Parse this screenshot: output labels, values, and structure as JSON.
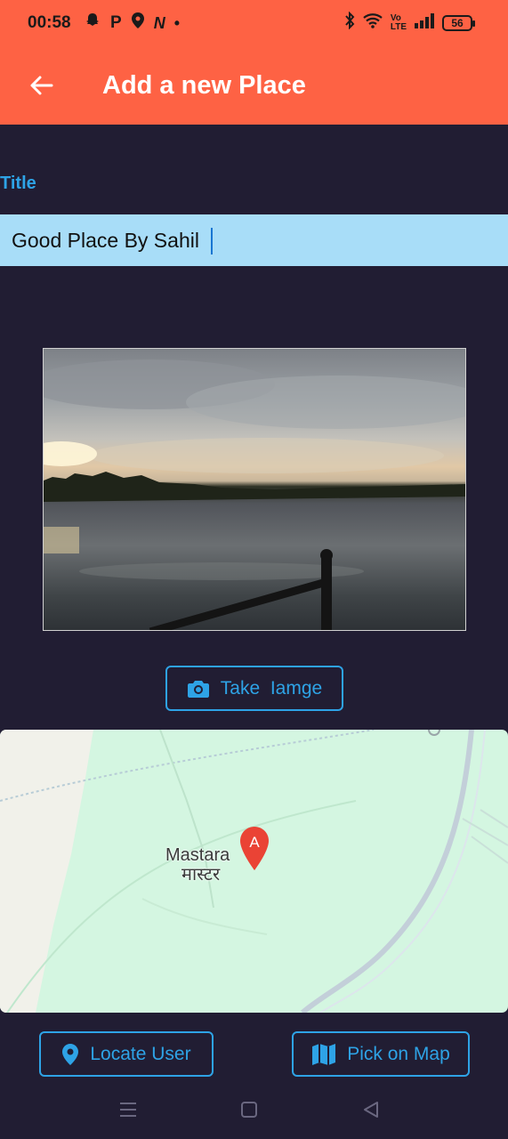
{
  "status_bar": {
    "time": "00:58",
    "battery": "56",
    "left_icons": [
      "snapchat-icon",
      "p-icon",
      "location-pin-icon",
      "n-icon",
      "dot-icon"
    ],
    "right_icons": [
      "bluetooth-icon",
      "wifi-icon",
      "volte-icon",
      "signal-icon"
    ]
  },
  "app_bar": {
    "title": "Add a new Place",
    "color": "#fe6244"
  },
  "form": {
    "title_label": "Title",
    "title_value": "Good Place By Sahil"
  },
  "image_section": {
    "take_image_label": "Take  Iamge"
  },
  "map": {
    "place_name": "Mastara",
    "place_name_local": "मास्टर",
    "marker_label": "A"
  },
  "actions": {
    "locate_user_label": "Locate User",
    "pick_on_map_label": "Pick on Map"
  },
  "colors": {
    "background": "#211d33",
    "accent": "#2ea3e6",
    "input_bg": "#a8ddf8"
  }
}
